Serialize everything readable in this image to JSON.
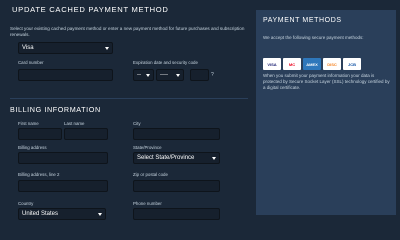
{
  "header": {
    "title": "UPDATE CACHED PAYMENT METHOD"
  },
  "payment": {
    "intro": "Select your existing cached payment method or enter a new payment method for future purchases and subscription renewals.",
    "method_value": "Visa",
    "card_number_label": "Card number",
    "expiration_label": "Expiration date and security code",
    "month_value": "--",
    "year_value": "----",
    "help_glyph": "?"
  },
  "billing": {
    "title": "BILLING INFORMATION",
    "first_name_label": "First name",
    "last_name_label": "Last name",
    "city_label": "City",
    "address_label": "Billing address",
    "state_label": "State/Province",
    "state_value": "Select State/Province",
    "address2_label": "Billing address, line 2",
    "zip_label": "Zip or postal code",
    "country_label": "Country",
    "country_value": "United States",
    "phone_label": "Phone number"
  },
  "sidebar": {
    "title": "PAYMENT METHODS",
    "accept_text": "We accept the following secure payment methods:",
    "cards": [
      "VISA",
      "MC",
      "AMEX",
      "DISC",
      "JCB"
    ],
    "secure_text": "When you submit your payment information your data is protected by Secure Socket Layer (SSL) technology certified by a digital certificate."
  },
  "colors": {
    "background": "#1b2838",
    "panel": "#2a3f5a",
    "field": "#16202d"
  }
}
